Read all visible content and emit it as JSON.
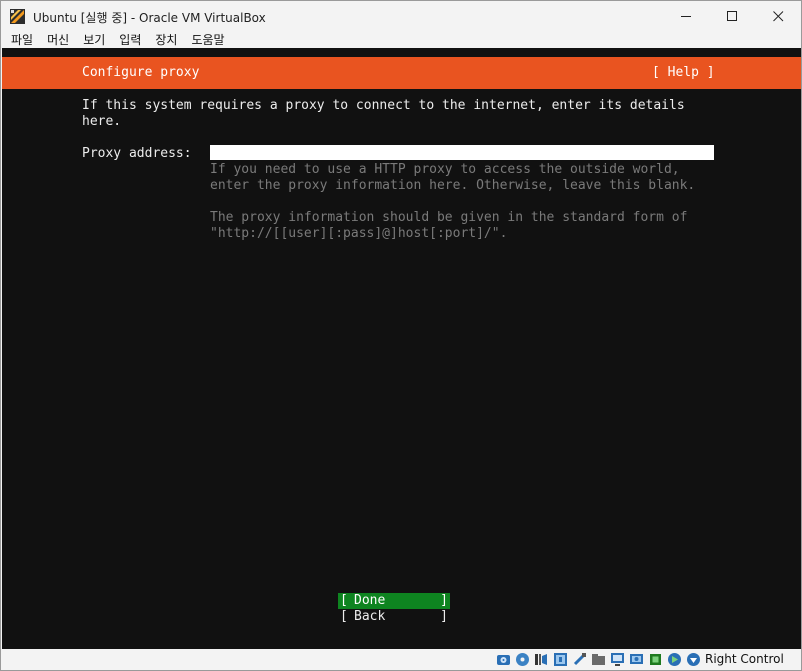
{
  "window": {
    "title": "Ubuntu [실행 중] - Oracle VM VirtualBox",
    "controls": [
      "minimize-icon",
      "maximize-icon",
      "close-icon"
    ]
  },
  "menu": {
    "items": [
      "파일",
      "머신",
      "보기",
      "입력",
      "장치",
      "도움말"
    ]
  },
  "screen": {
    "header_title": "Configure proxy",
    "help_label": "[ Help ]",
    "header_color": "#e95420",
    "intro": "If this system requires a proxy to connect to the internet, enter its details\nhere.",
    "proxy_label": "Proxy address:",
    "proxy_value": "",
    "hint1": "If you need to use a HTTP proxy to access the outside world,\nenter the proxy information here. Otherwise, leave this blank.",
    "hint2": "The proxy information should be given in the standard form of\n\"http://[[user][:pass]@]host[:port]/\".",
    "buttons": {
      "done": "Done",
      "back": "Back",
      "done_color": "#0e8420"
    }
  },
  "statusbar": {
    "icons": [
      "hard-disk-icon",
      "optical-drive-icon",
      "audio-icon",
      "network-icon",
      "usb-icon",
      "shared-folders-icon",
      "display-icon",
      "video-capture-icon",
      "cpu-icon",
      "mouse-integration-icon",
      "keyboard-icon"
    ],
    "host_key": "Right Control"
  }
}
